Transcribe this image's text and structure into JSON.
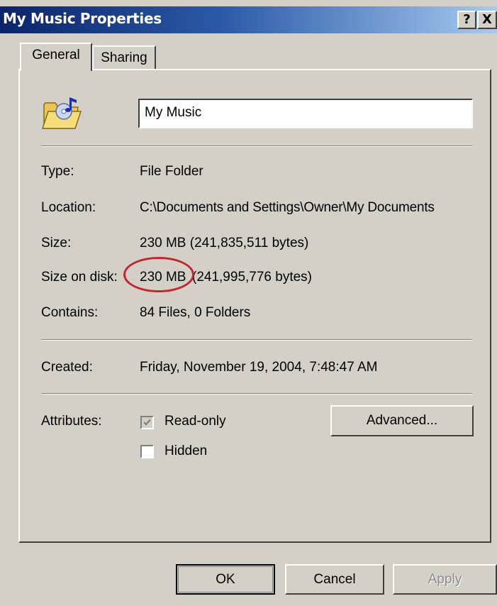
{
  "window": {
    "title": "My Music Properties",
    "help_label": "?",
    "close_label": "X"
  },
  "tabs": [
    {
      "label": "General",
      "active": true
    },
    {
      "label": "Sharing",
      "active": false
    }
  ],
  "general": {
    "folder_icon": "music-folder-icon",
    "name_value": "My Music",
    "rows": {
      "type": {
        "label": "Type:",
        "value": "File Folder"
      },
      "location": {
        "label": "Location:",
        "value": "C:\\Documents and Settings\\Owner\\My Documents"
      },
      "size": {
        "label": "Size:",
        "value": "230 MB (241,835,511 bytes)"
      },
      "size_on_disk": {
        "label": "Size on disk:",
        "value_highlight": "230 MB",
        "value_rest": "(241,995,776 bytes)"
      },
      "contains": {
        "label": "Contains:",
        "value": "84 Files, 0 Folders"
      },
      "created": {
        "label": "Created:",
        "value": "Friday, November 19, 2004, 7:48:47 AM"
      }
    },
    "attributes": {
      "label": "Attributes:",
      "read_only": {
        "label": "Read-only",
        "checked": true,
        "disabled": true
      },
      "hidden": {
        "label": "Hidden",
        "checked": false
      },
      "advanced_label": "Advanced..."
    },
    "annotation_color": "#c0282d"
  },
  "buttons": {
    "ok": "OK",
    "cancel": "Cancel",
    "apply": "Apply"
  }
}
